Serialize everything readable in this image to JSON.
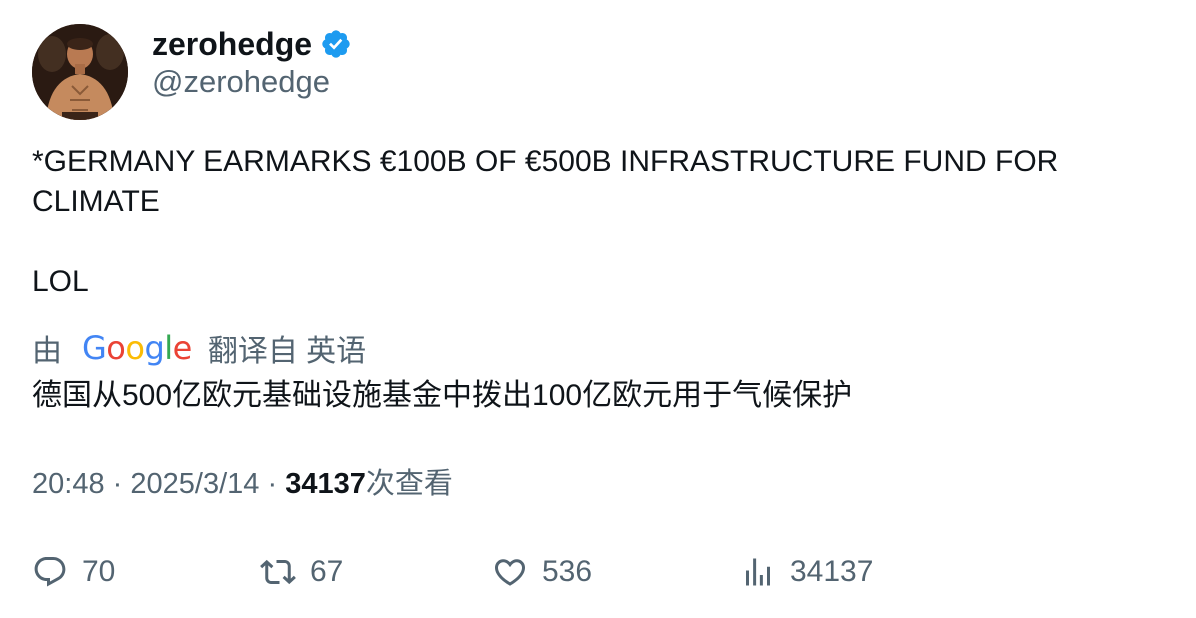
{
  "author": {
    "display_name": "zerohedge",
    "handle": "@zerohedge",
    "verified": true,
    "verified_icon": "verified-badge-icon",
    "verified_color": "#1d9bf0",
    "avatar": "avatar-photo"
  },
  "tweet": {
    "text_line1": "*GERMANY EARMARKS €100B OF €500B INFRASTRUCTURE FUND FOR CLIMATE",
    "text_line2": "LOL"
  },
  "translation": {
    "prefix": "由",
    "provider": "Google",
    "suffix": "翻译自 英语",
    "text": "德国从500亿欧元基础设施基金中拨出100亿欧元用于气候保护"
  },
  "meta": {
    "time": "20:48",
    "separator": "·",
    "date": "2025/3/14",
    "views_count": "34137",
    "views_label": "次查看"
  },
  "actions": {
    "replies": "70",
    "retweets": "67",
    "likes": "536",
    "views": "34137"
  },
  "colors": {
    "text_primary": "#0f1419",
    "text_secondary": "#536471",
    "accent": "#1d9bf0"
  }
}
